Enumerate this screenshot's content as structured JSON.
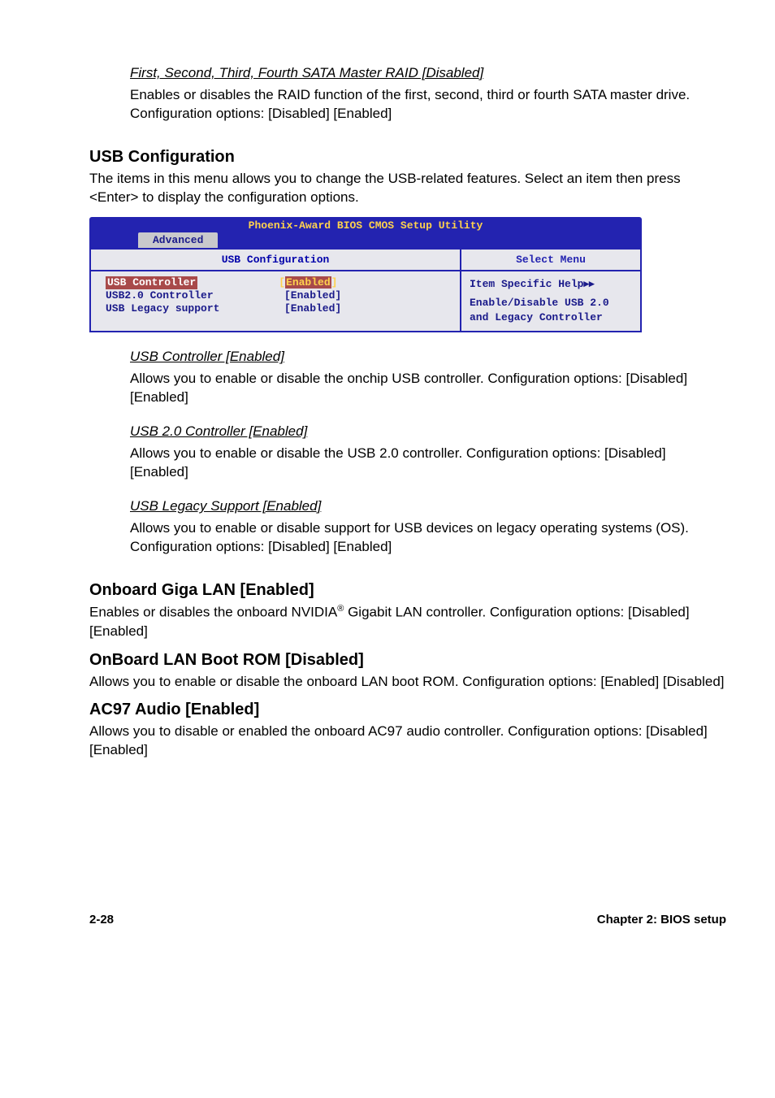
{
  "sect1": {
    "title": "First, Second, Third, Fourth SATA Master RAID [Disabled]",
    "body": "Enables or disables the RAID function of the first, second, third or fourth SATA master drive. Configuration options: [Disabled] [Enabled]"
  },
  "usb": {
    "heading": "USB Configuration",
    "intro": "The items in this menu allows you to change the USB-related features. Select an item then press <Enter> to display the configuration options."
  },
  "bios": {
    "title": "Phoenix-Award BIOS CMOS Setup Utility",
    "tab": "Advanced",
    "left_title": "USB Configuration",
    "right_title": "Select Menu",
    "rows": [
      {
        "label": "USB Controller",
        "value": "Enabled",
        "selected": true
      },
      {
        "label": "USB2.0 Controller",
        "value": "[Enabled]",
        "selected": false
      },
      {
        "label": "USB Legacy support",
        "value": "[Enabled]",
        "selected": false
      }
    ],
    "help_title": "Item Specific Help",
    "help_body": "Enable/Disable USB 2.0 and Legacy Controller"
  },
  "sub1": {
    "title": "USB Controller [Enabled]",
    "body": "Allows you to enable or disable the onchip USB controller. Configuration options: [Disabled] [Enabled]"
  },
  "sub2": {
    "title": "USB 2.0 Controller [Enabled]",
    "body": "Allows you to enable or disable the USB 2.0 controller. Configuration options: [Disabled] [Enabled]"
  },
  "sub3": {
    "title": "USB Legacy Support [Enabled]",
    "body": "Allows you to enable or disable support for USB devices on legacy operating systems (OS). Configuration options: [Disabled] [Enabled]"
  },
  "giga": {
    "heading": "Onboard Giga LAN [Enabled]",
    "body1": "Enables or disables the onboard NVIDIA",
    "reg": "®",
    "body2": " Gigabit LAN controller. Configuration options: [Disabled] [Enabled]"
  },
  "lanboot": {
    "heading": "OnBoard LAN Boot ROM [Disabled]",
    "body": "Allows you to enable or disable the onboard LAN boot ROM. Configuration options: [Enabled] [Disabled]"
  },
  "ac97": {
    "heading": "AC97 Audio [Enabled]",
    "body": "Allows you to disable or enabled  the onboard AC97 audio controller. Configuration options: [Disabled] [Enabled]"
  },
  "footer": {
    "left": "2-28",
    "right": "Chapter 2: BIOS setup"
  }
}
